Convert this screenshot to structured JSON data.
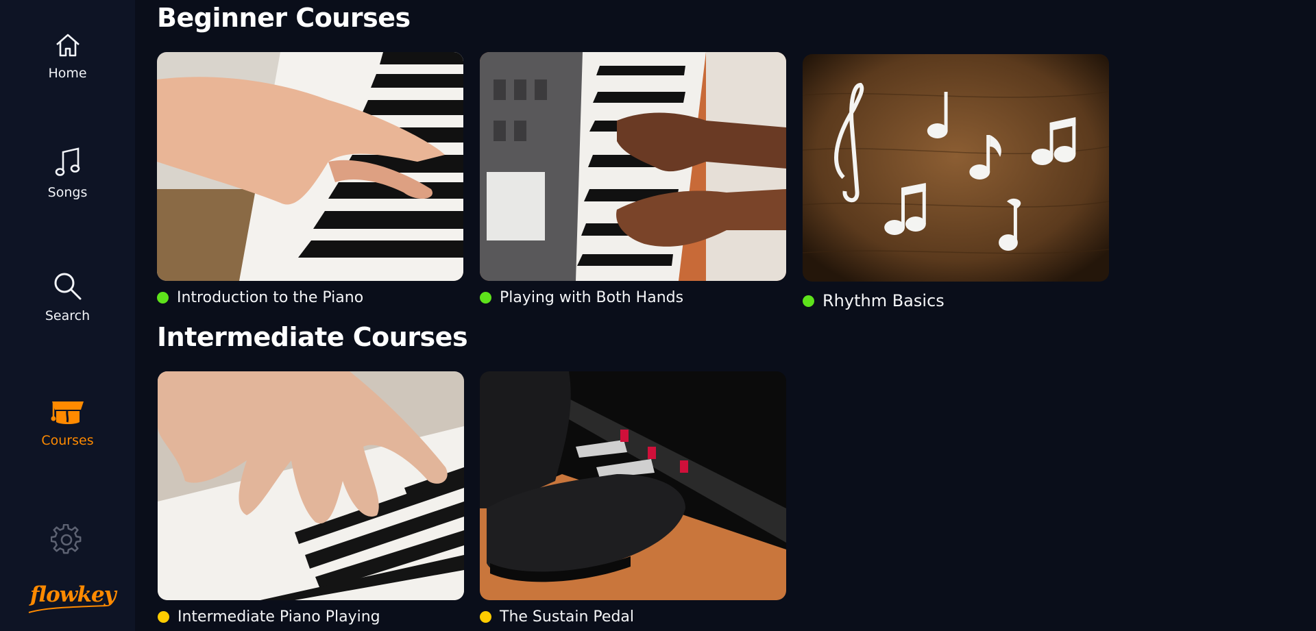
{
  "sidebar": {
    "items": [
      {
        "label": "Home",
        "icon": "home-icon"
      },
      {
        "label": "Songs",
        "icon": "music-note-icon"
      },
      {
        "label": "Search",
        "icon": "search-icon"
      },
      {
        "label": "Courses",
        "icon": "graduation-cap-icon",
        "active": true
      }
    ],
    "settings_icon": "gear-icon",
    "logo_text": "flowkey"
  },
  "sections": [
    {
      "title": "Beginner Courses",
      "courses": [
        {
          "title": "Introduction to the Piano",
          "level_color": "#5ee21b"
        },
        {
          "title": "Playing with Both Hands",
          "level_color": "#5ee21b"
        },
        {
          "title": "Rhythm Basics",
          "level_color": "#5ee21b"
        }
      ]
    },
    {
      "title": "Intermediate Courses",
      "courses": [
        {
          "title": "Intermediate Piano Playing",
          "level_color": "#ffcc00"
        },
        {
          "title": "The Sustain Pedal",
          "level_color": "#ffcc00"
        }
      ]
    }
  ],
  "colors": {
    "accent": "#ff8a00",
    "beginner": "#5ee21b",
    "intermediate": "#ffcc00",
    "background": "#0a0e1a",
    "sidebar": "#0e1425"
  }
}
